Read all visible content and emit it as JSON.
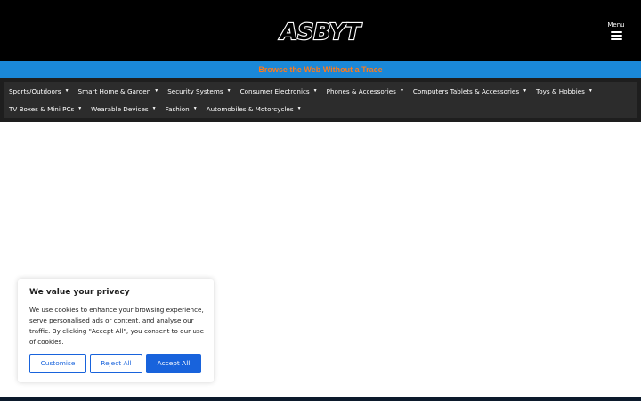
{
  "header": {
    "logo_text": "ASBYT",
    "menu_label": "Menu"
  },
  "promo": {
    "text": "Browse the Web Without a Trace"
  },
  "nav": {
    "items": [
      {
        "label": "Sports/Outdoors"
      },
      {
        "label": "Smart Home & Garden"
      },
      {
        "label": "Security Systems"
      },
      {
        "label": "Consumer Electronics"
      },
      {
        "label": "Phones & Accessories"
      },
      {
        "label": "Computers Tablets & Accessories"
      },
      {
        "label": "Toys & Hobbies"
      },
      {
        "label": "TV Boxes & Mini PCs"
      },
      {
        "label": "Wearable Devices"
      },
      {
        "label": "Fashion"
      },
      {
        "label": "Automobiles & Motorcycles"
      }
    ]
  },
  "cookie": {
    "title": "We value your privacy",
    "text": "We use cookies to enhance your browsing experience, serve personalised ads or content, and analyse our traffic. By clicking \"Accept All\", you consent to our use of cookies.",
    "customise": "Customise",
    "reject": "Reject All",
    "accept": "Accept All"
  },
  "colors": {
    "header_bg": "#000000",
    "promo_bg": "#1a88d8",
    "promo_text": "#ff7a1a",
    "nav_bg": "#2c2c2c",
    "accent": "#1863dc"
  }
}
